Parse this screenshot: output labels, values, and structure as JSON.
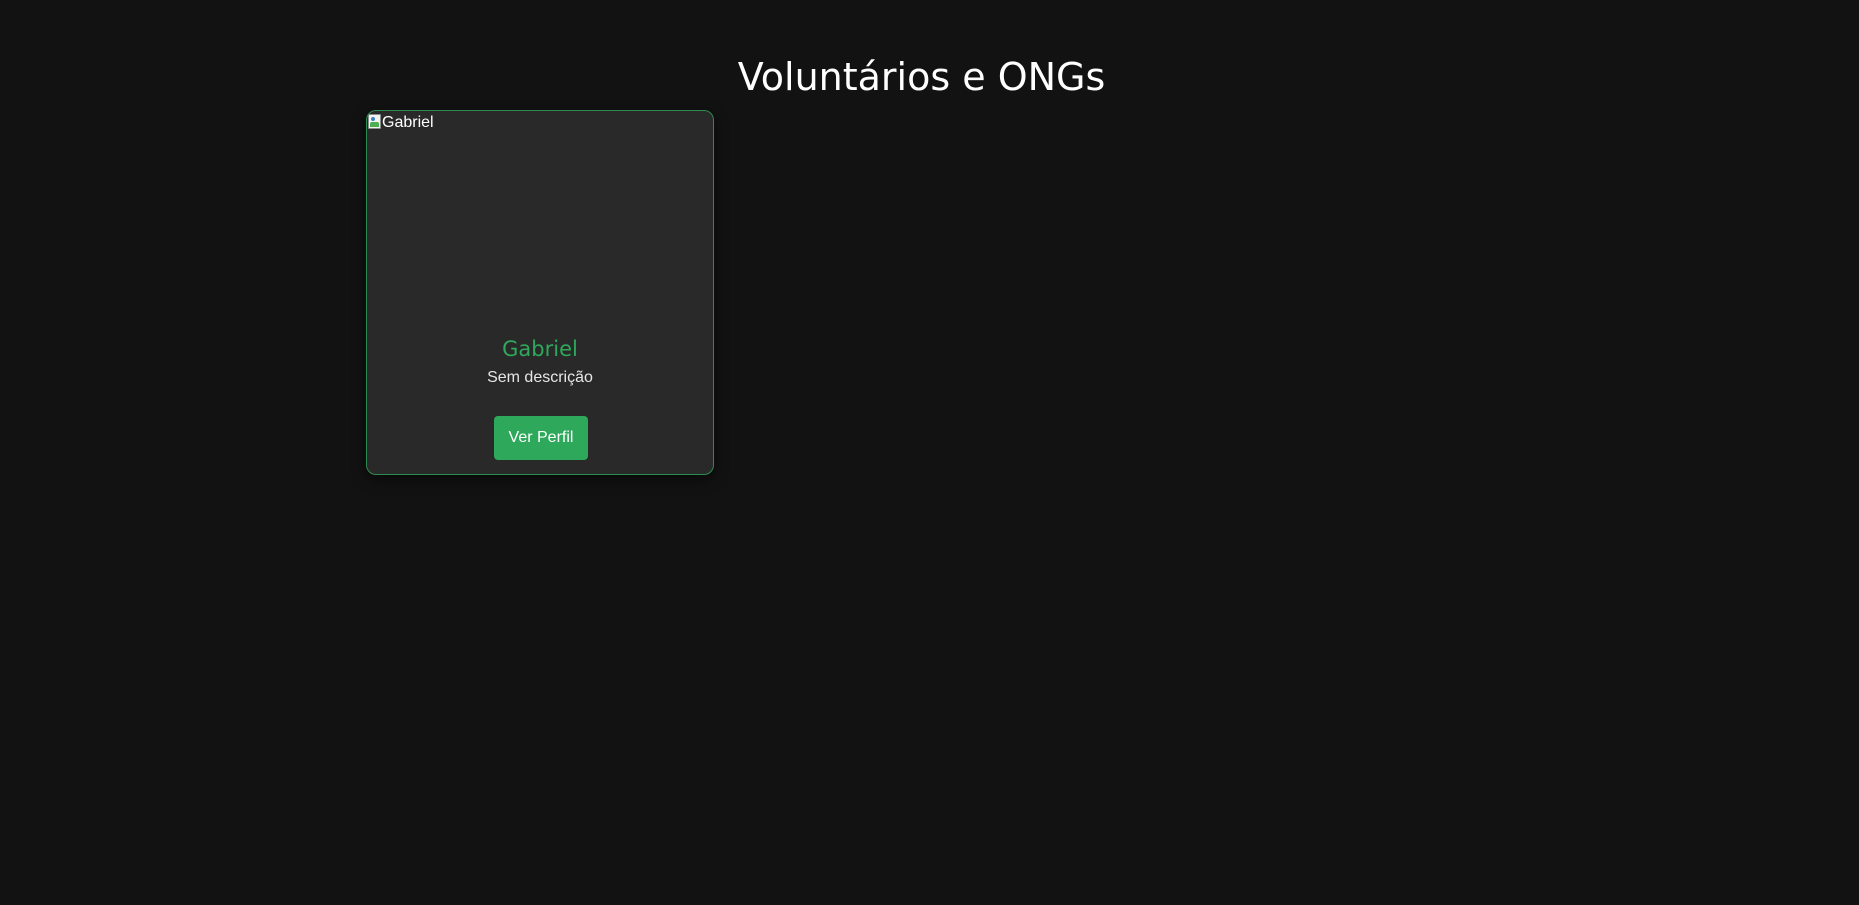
{
  "page": {
    "title": "Voluntários e ONGs"
  },
  "cards": [
    {
      "image_alt": "Gabriel",
      "name": "Gabriel",
      "description": "Sem descrição",
      "button_label": "Ver Perfil"
    }
  ],
  "colors": {
    "background": "#121212",
    "card_background": "#292929",
    "accent": "#2ea85a",
    "text": "#ffffff"
  },
  "icons": {
    "avatar_placeholder": "broken-image-icon"
  }
}
